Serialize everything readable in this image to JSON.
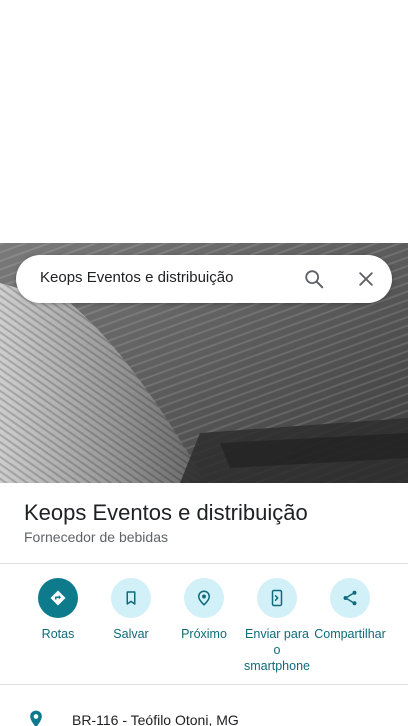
{
  "search": {
    "query": "Keops Eventos e distribuição",
    "search_icon": "search-icon",
    "close_icon": "close-icon"
  },
  "place": {
    "name": "Keops Eventos e distribuição",
    "category": "Fornecedor de bebidas",
    "address": "BR-116 - Teófilo Otoni, MG"
  },
  "actions": [
    {
      "label": "Rotas",
      "icon": "directions-icon"
    },
    {
      "label": "Salvar",
      "icon": "bookmark-icon"
    },
    {
      "label": "Próximo",
      "icon": "nearby-icon"
    },
    {
      "label": "Enviar para o smartphone",
      "icon": "send-to-phone-icon"
    },
    {
      "label": "Compartilhar",
      "icon": "share-icon"
    }
  ],
  "colors": {
    "accent": "#0e7b8c",
    "accent_light": "#d2f0f7",
    "text_primary": "#202124",
    "text_secondary": "#5f6368"
  }
}
